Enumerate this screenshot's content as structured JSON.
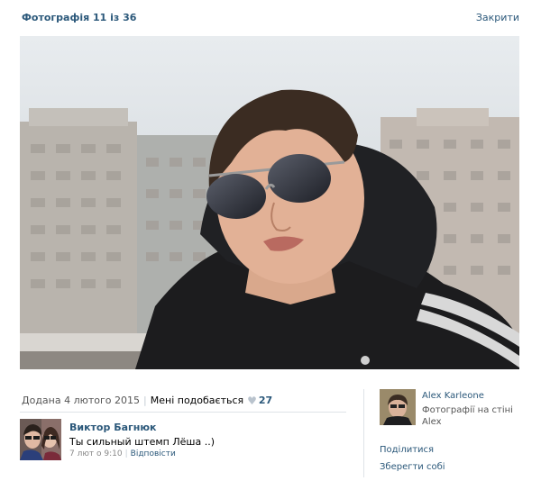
{
  "header": {
    "title": "Фотографія 11 із 36",
    "close_label": "Закрити"
  },
  "photo_meta": {
    "added": "Додана 4 лютого 2015",
    "like_label": "Мені подобається",
    "like_icon": "heart-icon",
    "like_count": "27"
  },
  "comment": {
    "author": "Виктор Багнюк",
    "text": "Ты сильный штемп Лёша ..)",
    "time": "7 лют о 9:10",
    "reply_label": "Відповісти"
  },
  "owner": {
    "name": "Alex Karleone",
    "location_line1": "Фотографії на стіні",
    "location_line2": "Alex"
  },
  "actions": {
    "share_label": "Поділитися",
    "save_label": "Зберегти собі"
  },
  "colors": {
    "link": "#2b587a",
    "divider": "#dfe3e8",
    "muted": "#555555"
  }
}
